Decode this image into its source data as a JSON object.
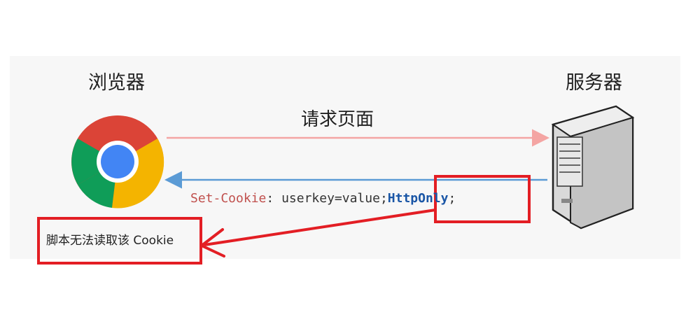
{
  "labels": {
    "browser": "浏览器",
    "server": "服务器",
    "request": "请求页面",
    "note": "脚本无法读取该 Cookie"
  },
  "response": {
    "header_name": "Set-Cookie",
    "separator": ": ",
    "value": "userkey=value;",
    "flag": "HttpOnly",
    "terminator": ";"
  },
  "colors": {
    "request_arrow": "#f4a5a3",
    "response_arrow": "#5b9bd5",
    "highlight_box": "#e31e24",
    "header_name": "#c0504d",
    "flag": "#1a56a6"
  },
  "icons": {
    "browser": "chrome-logo-icon",
    "server": "server-tower-icon"
  }
}
